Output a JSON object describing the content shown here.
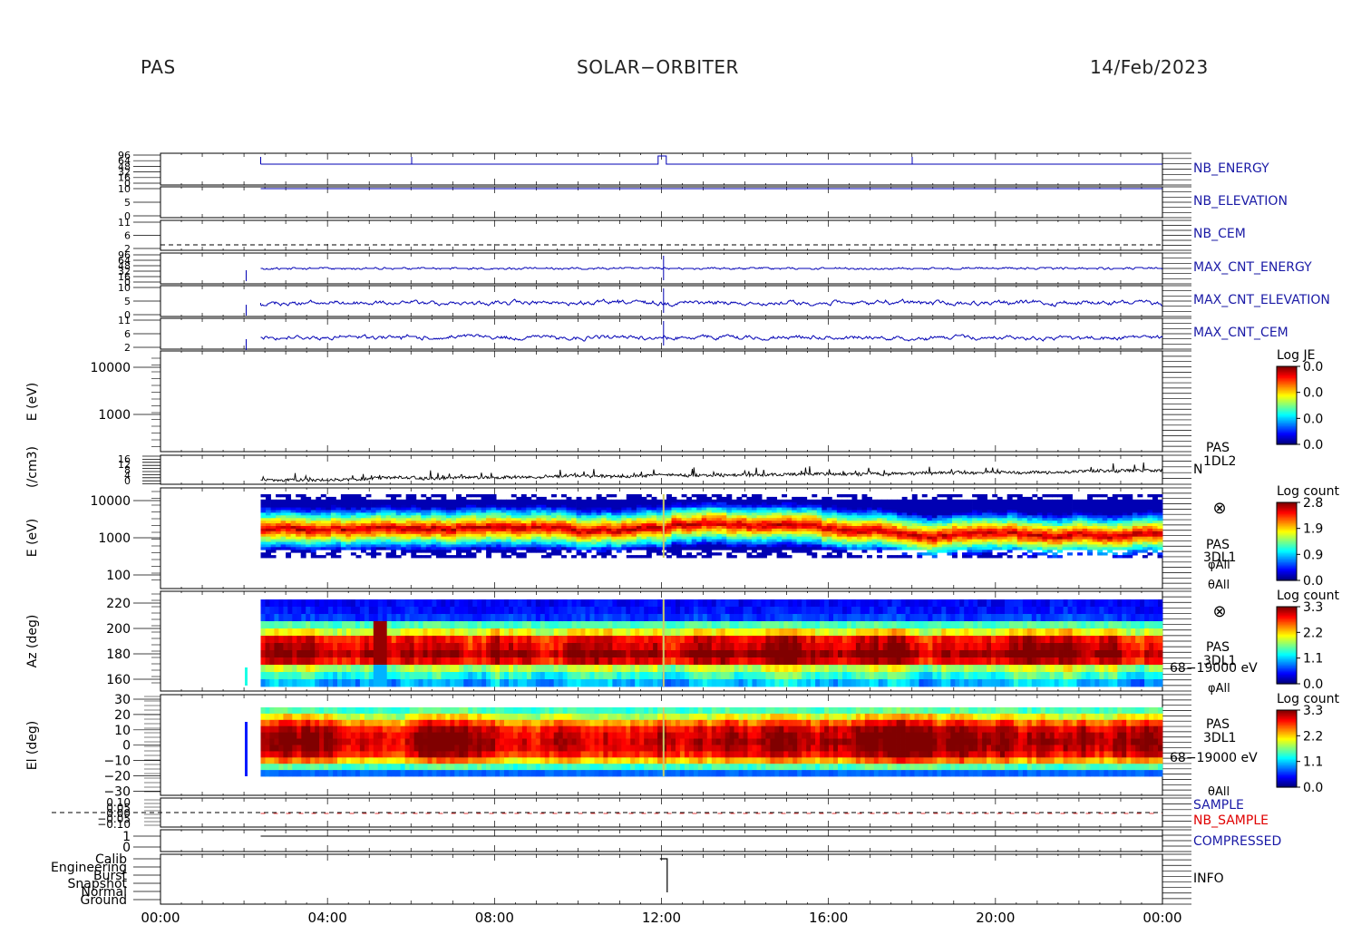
{
  "header": {
    "left": "PAS",
    "center": "SOLAR−ORBITER",
    "right": "14/Feb/2023"
  },
  "colors": {
    "axis": "#000000",
    "housekeeping_line": "#0000b4",
    "label_blue": "#1a1aa6",
    "label_red": "#e00000"
  },
  "chart_data": {
    "type": "heatmap",
    "x_ticks": [
      "00:00",
      "04:00",
      "08:00",
      "12:00",
      "16:00",
      "20:00",
      "00:00"
    ],
    "x_range_hours": [
      0,
      24
    ],
    "data_start_hour": 2.4,
    "data_gap_hour": 12.05,
    "panels": [
      {
        "id": "nb_energy",
        "label": "NB_ENERGY",
        "label_color": "blue",
        "ticks": [
          "96",
          "64",
          "48",
          "32",
          "16",
          "0"
        ]
      },
      {
        "id": "nb_elevation",
        "label": "NB_ELEVATION",
        "label_color": "blue",
        "ticks": [
          "10",
          "5",
          "0"
        ]
      },
      {
        "id": "nb_cem",
        "label": "NB_CEM",
        "label_color": "blue",
        "ticks": [
          "11",
          "6",
          "2"
        ]
      },
      {
        "id": "max_cnt_energy",
        "label": "MAX_CNT_ENERGY",
        "label_color": "blue",
        "ticks": [
          "96",
          "64",
          "48",
          "32",
          "16",
          "0"
        ]
      },
      {
        "id": "max_cnt_elevation",
        "label": "MAX_CNT_ELEVATION",
        "label_color": "blue",
        "ticks": [
          "10",
          "5",
          "0"
        ]
      },
      {
        "id": "max_cnt_cem",
        "label": "MAX_CNT_CEM",
        "label_color": "blue",
        "ticks": [
          "11",
          "6",
          "2"
        ]
      },
      {
        "id": "spec_1dl2",
        "ylabel": "E (eV)",
        "ticks": [
          "10000",
          "1000"
        ],
        "colorbar": {
          "title": "Log JE",
          "ticks": [
            "0.0",
            "0.0",
            "0.0",
            "0.0"
          ]
        }
      },
      {
        "id": "density",
        "ylabel": "(/cm3)",
        "ticks": [
          "16",
          "12",
          "8",
          "4",
          "0"
        ],
        "labels": [
          "PAS",
          "1DL2",
          "N"
        ]
      },
      {
        "id": "spec_3dl1_energy",
        "ylabel": "E (eV)",
        "ticks": [
          "10000",
          "1000",
          "100"
        ],
        "colorbar": {
          "title": "Log count",
          "ticks": [
            "2.8",
            "1.9",
            "0.9",
            "0.0"
          ]
        },
        "labels": [
          "PAS",
          "3DL1",
          "φAll",
          "θAll"
        ]
      },
      {
        "id": "spec_3dl1_az",
        "ylabel": "Az (deg)",
        "ticks": [
          "220",
          "200",
          "180",
          "160"
        ],
        "colorbar": {
          "title": "Log count",
          "ticks": [
            "3.3",
            "2.2",
            "1.1",
            "0.0"
          ]
        },
        "labels": [
          "PAS",
          "3DL1",
          "68−19000 eV",
          "φAll"
        ]
      },
      {
        "id": "spec_3dl1_el",
        "ylabel": "El (deg)",
        "ticks": [
          "30",
          "20",
          "10",
          "0",
          "−10",
          "−20",
          "−30"
        ],
        "colorbar": {
          "title": "Log count",
          "ticks": [
            "3.3",
            "2.2",
            "1.1",
            "0.0"
          ]
        },
        "labels": [
          "PAS",
          "3DL1",
          "68−19000 eV",
          "θAll"
        ]
      },
      {
        "id": "sample",
        "labels": [
          "SAMPLE",
          "NB_SAMPLE"
        ],
        "ticks": [
          "0.10",
          "0.05",
          "0.00",
          "−0.05",
          "−0.10"
        ]
      },
      {
        "id": "compressed",
        "label": "COMPRESSED",
        "label_color": "blue",
        "ticks": [
          "1",
          "0"
        ]
      },
      {
        "id": "info",
        "label": "INFO",
        "label_color": "black",
        "ticks": [
          "Calib",
          "Engineering",
          "Burst",
          "Snapshot",
          "Normal",
          "Ground"
        ]
      }
    ]
  }
}
